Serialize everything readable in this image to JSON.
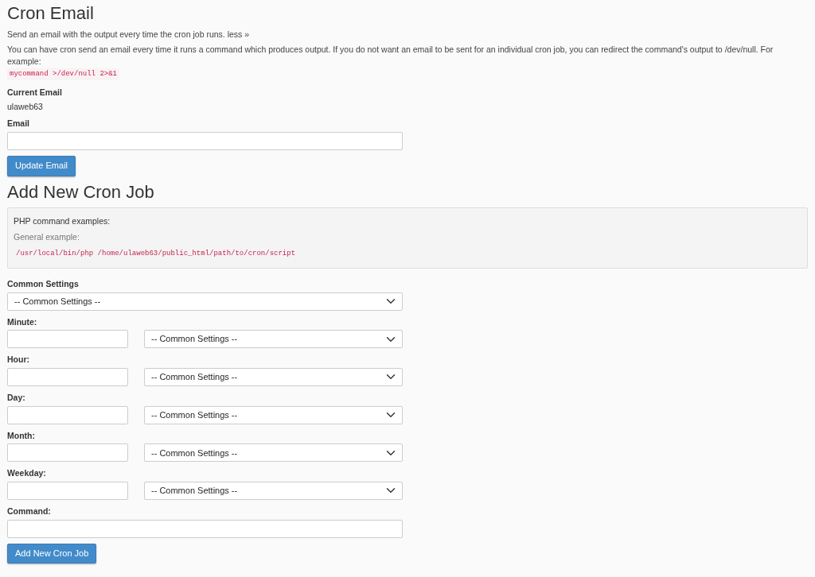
{
  "email_section": {
    "title": "Cron Email",
    "summary": "Send an email with the output every time the cron job runs.",
    "summary_link": "less »",
    "description": "You can have cron send an email every time it runs a command which produces output. If you do not want an email to be sent for an individual cron job, you can redirect the command's output to /dev/null. For example:",
    "example_code": "mycommand >/dev/null 2>&1",
    "current_email_label": "Current Email",
    "current_email": "ulaweb63",
    "email_label": "Email",
    "update_button": "Update Email"
  },
  "add_section": {
    "title": "Add New Cron Job",
    "examples_heading": "PHP command examples:",
    "general_label": "General example:",
    "general_code": "/usr/local/bin/php /home/ulaweb63/public_html/path/to/cron/script",
    "common_label": "Common Settings",
    "common_value": "-- Common Settings --",
    "fields": [
      {
        "label": "Minute:",
        "select_value": "-- Common Settings --"
      },
      {
        "label": "Hour:",
        "select_value": "-- Common Settings --"
      },
      {
        "label": "Day:",
        "select_value": "-- Common Settings --"
      },
      {
        "label": "Month:",
        "select_value": "-- Common Settings --"
      },
      {
        "label": "Weekday:",
        "select_value": "-- Common Settings --"
      }
    ],
    "command_label": "Command:",
    "add_button": "Add New Cron Job"
  }
}
